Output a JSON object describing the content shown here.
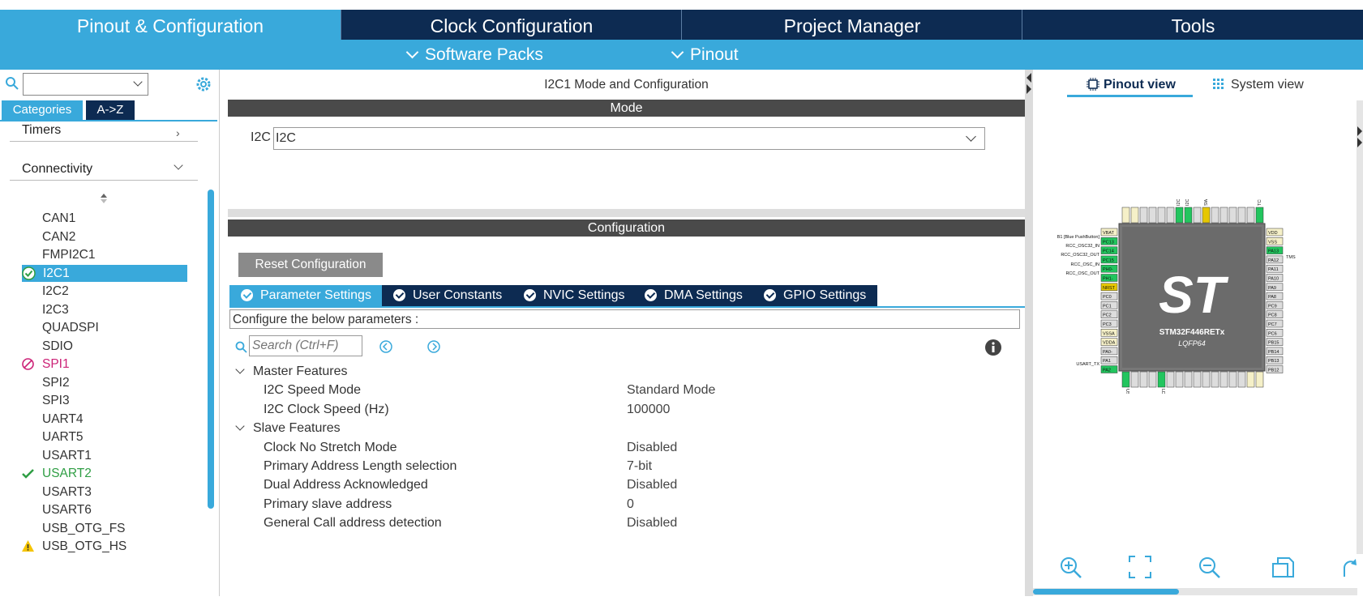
{
  "top_tabs": [
    {
      "label": "Pinout & Configuration",
      "active": true
    },
    {
      "label": "Clock Configuration",
      "active": false
    },
    {
      "label": "Project Manager",
      "active": false
    },
    {
      "label": "Tools",
      "active": false
    }
  ],
  "sub_menu": [
    {
      "label": "Software Packs"
    },
    {
      "label": "Pinout"
    }
  ],
  "left_panel": {
    "search_value": "",
    "tabs": [
      {
        "label": "Categories",
        "active": true
      },
      {
        "label": "A->Z",
        "active": false
      }
    ],
    "categories": [
      {
        "label": "Timers"
      },
      {
        "label": "Connectivity"
      }
    ],
    "items": [
      {
        "label": "CAN1",
        "status": ""
      },
      {
        "label": "CAN2",
        "status": ""
      },
      {
        "label": "FMPI2C1",
        "status": ""
      },
      {
        "label": "I2C1",
        "status": "ok"
      },
      {
        "label": "I2C2",
        "status": ""
      },
      {
        "label": "I2C3",
        "status": ""
      },
      {
        "label": "QUADSPI",
        "status": ""
      },
      {
        "label": "SDIO",
        "status": ""
      },
      {
        "label": "SPI1",
        "status": "conflict"
      },
      {
        "label": "SPI2",
        "status": ""
      },
      {
        "label": "SPI3",
        "status": ""
      },
      {
        "label": "UART4",
        "status": ""
      },
      {
        "label": "UART5",
        "status": ""
      },
      {
        "label": "USART1",
        "status": ""
      },
      {
        "label": "USART2",
        "status": "configured"
      },
      {
        "label": "USART3",
        "status": ""
      },
      {
        "label": "USART6",
        "status": ""
      },
      {
        "label": "USB_OTG_FS",
        "status": ""
      },
      {
        "label": "USB_OTG_HS",
        "status": "warning"
      }
    ],
    "selected_item": "I2C1"
  },
  "middle_panel": {
    "title": "I2C1 Mode and Configuration",
    "mode_header": "Mode",
    "mode_label": "I2C",
    "mode_value": "I2C",
    "config_header": "Configuration",
    "reset_button": "Reset Configuration",
    "tabs": [
      {
        "label": "Parameter Settings",
        "active": true
      },
      {
        "label": "User Constants",
        "active": false
      },
      {
        "label": "NVIC Settings",
        "active": false
      },
      {
        "label": "DMA Settings",
        "active": false
      },
      {
        "label": "GPIO Settings",
        "active": false
      }
    ],
    "configure_text": "Configure the below parameters :",
    "search_placeholder": "Search (Ctrl+F)",
    "groups": [
      {
        "name": "Master Features",
        "params": [
          {
            "name": "I2C Speed Mode",
            "value": "Standard Mode"
          },
          {
            "name": "I2C Clock Speed (Hz)",
            "value": "100000"
          }
        ]
      },
      {
        "name": "Slave Features",
        "params": [
          {
            "name": "Clock No Stretch Mode",
            "value": "Disabled"
          },
          {
            "name": "Primary Address Length selection",
            "value": "7-bit"
          },
          {
            "name": "Dual Address Acknowledged",
            "value": "Disabled"
          },
          {
            "name": "Primary slave address",
            "value": "0"
          },
          {
            "name": "General Call address detection",
            "value": "Disabled"
          }
        ]
      }
    ]
  },
  "right_panel": {
    "view_tabs": [
      {
        "label": "Pinout view",
        "active": true
      },
      {
        "label": "System view",
        "active": false
      }
    ],
    "chip_name": "STM32F446RETx",
    "chip_package": "LQFP64",
    "left_pin_labels": [
      "B1 [Blue PushButton]",
      "RCC_OSC32_IN",
      "RCC_OSC32_OUT",
      "RCC_OSC_IN",
      "RCC_OSC_OUT",
      "USART_TX"
    ],
    "left_pins": [
      "VBAT",
      "PC13",
      "PC14",
      "PC15",
      "PH0-",
      "PH1-",
      "NRST",
      "PC0",
      "PC1",
      "PC2",
      "PC3",
      "VSSA",
      "VDDA",
      "PA0-",
      "PA1",
      "PA2"
    ],
    "right_pins": [
      "VDD",
      "VSS",
      "PA13",
      "PA12",
      "PA11",
      "PA10",
      "PA9",
      "PA8",
      "PC9",
      "PC8",
      "PC7",
      "PC6",
      "PB15",
      "PB14",
      "PB13",
      "PB12"
    ],
    "top_pin_labels": [
      "I2C1_SDA",
      "I2C1_SCL",
      "SWO",
      "TCK"
    ],
    "right_pin_label": "TMS",
    "bottom_pin_labels": [
      "USART_RX",
      "LD2 [Green Led]"
    ],
    "colors": {
      "accent": "#39a9db",
      "navy": "#0d2b52",
      "green_pin": "#22c55e",
      "yellow_pin": "#e6c700",
      "chip_body": "#6b6b6b"
    }
  }
}
